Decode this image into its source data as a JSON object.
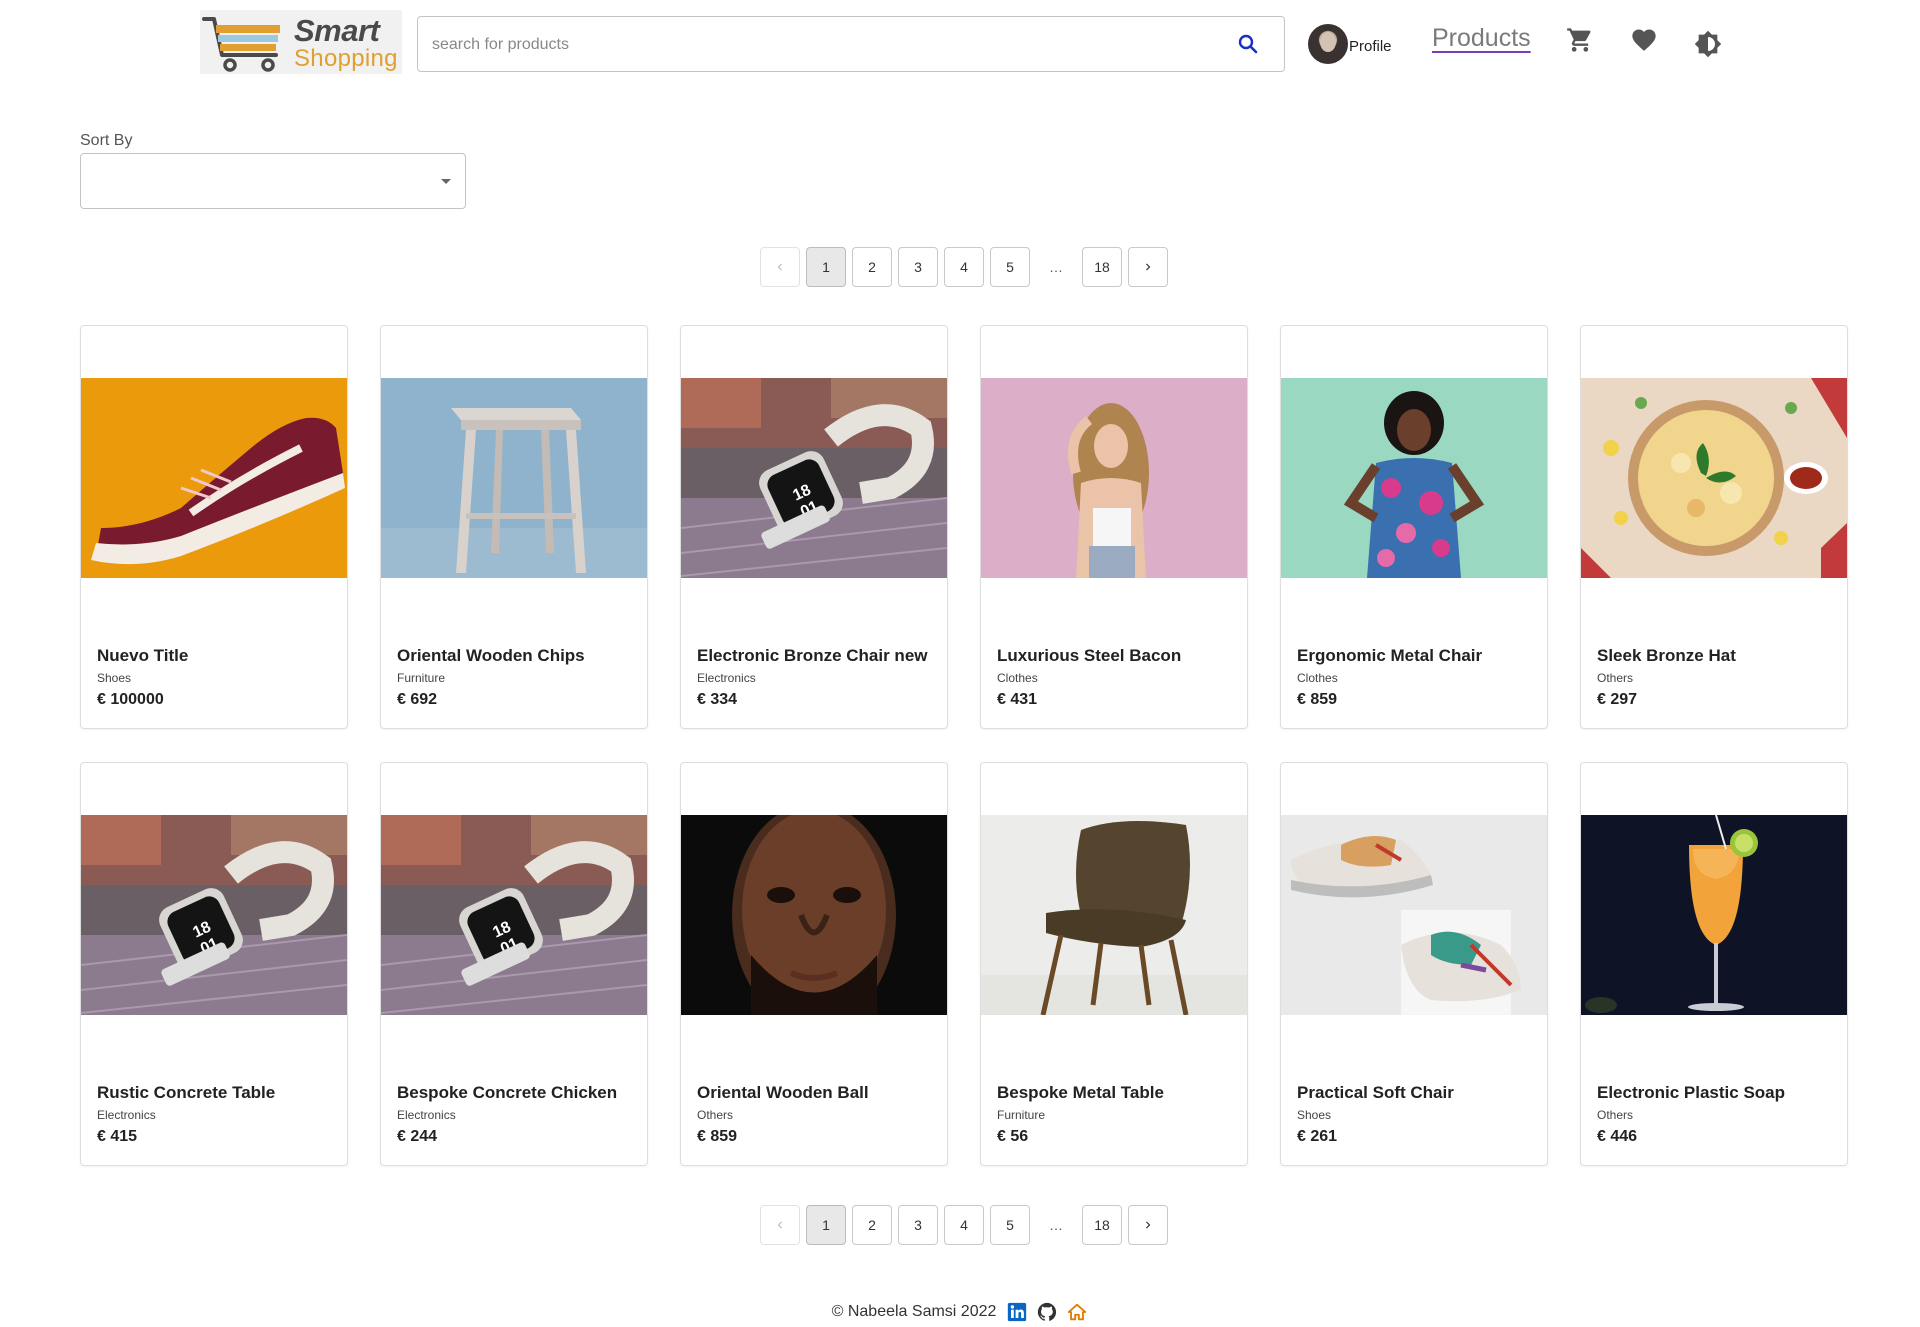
{
  "header": {
    "logo": {
      "word1": "Smart",
      "word2": "Shopping"
    },
    "search_placeholder": "search for products",
    "search_value": "",
    "profile_label": "Profile",
    "nav_products": "Products",
    "icons": [
      "shopping-cart-icon",
      "heart-icon",
      "brightness-icon"
    ]
  },
  "sort": {
    "label": "Sort By",
    "value": ""
  },
  "pagination": {
    "pages": [
      "1",
      "2",
      "3",
      "4",
      "5",
      "…",
      "18"
    ],
    "current": "1"
  },
  "products": [
    {
      "title": "Nuevo Title",
      "category": "Shoes",
      "price": "€ 100000",
      "image": "maroon-sneaker"
    },
    {
      "title": "Oriental Wooden Chips",
      "category": "Furniture",
      "price": "€ 692",
      "image": "wooden-stool"
    },
    {
      "title": "Electronic Bronze Chair new",
      "category": "Electronics",
      "price": "€ 334",
      "image": "smartwatch"
    },
    {
      "title": "Luxurious Steel Bacon",
      "category": "Clothes",
      "price": "€ 431",
      "image": "woman-pink"
    },
    {
      "title": "Ergonomic Metal Chair",
      "category": "Clothes",
      "price": "€ 859",
      "image": "woman-dress"
    },
    {
      "title": "Sleek Bronze Hat",
      "category": "Others",
      "price": "€ 297",
      "image": "pizza"
    },
    {
      "title": "Rustic Concrete Table",
      "category": "Electronics",
      "price": "€ 415",
      "image": "smartwatch"
    },
    {
      "title": "Bespoke Concrete Chicken",
      "category": "Electronics",
      "price": "€ 244",
      "image": "smartwatch"
    },
    {
      "title": "Oriental Wooden Ball",
      "category": "Others",
      "price": "€ 859",
      "image": "man-portrait"
    },
    {
      "title": "Bespoke Metal Table",
      "category": "Furniture",
      "price": "€ 56",
      "image": "velvet-chair"
    },
    {
      "title": "Practical Soft Chair",
      "category": "Shoes",
      "price": "€ 261",
      "image": "sneakers-pair"
    },
    {
      "title": "Electronic Plastic Soap",
      "category": "Others",
      "price": "€ 446",
      "image": "orange-cocktail"
    }
  ],
  "footer": {
    "text": "© Nabeela Samsi 2022",
    "icons": [
      "linkedin-icon",
      "github-icon",
      "home-icon"
    ]
  },
  "colors": {
    "accent_underline": "#7a3fb0",
    "logo_orange": "#e0a030",
    "linkedin_blue": "#0a66c2",
    "home_orange": "#e07b00"
  }
}
